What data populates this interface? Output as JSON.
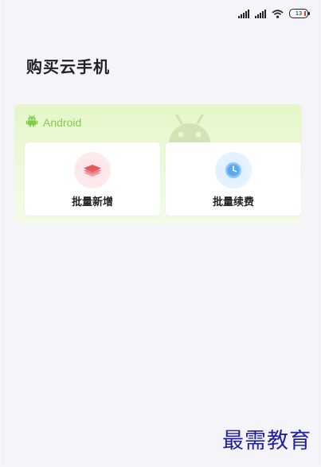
{
  "status_bar": {
    "battery_level": "13",
    "icons": [
      "signal-icon",
      "signal-icon",
      "wifi-icon",
      "battery-icon"
    ],
    "battery_low_color": "#e53935"
  },
  "page": {
    "title": "购买云手机"
  },
  "platform_card": {
    "platform_label": "Android",
    "accent_color": "#7fce4a",
    "actions": [
      {
        "label": "批量新增",
        "icon": "stack-layers-icon",
        "icon_color": "#e8585f"
      },
      {
        "label": "批量续费",
        "icon": "clock-icon",
        "icon_color": "#4a9fe8"
      }
    ]
  },
  "watermark": {
    "text": "最需教育"
  }
}
